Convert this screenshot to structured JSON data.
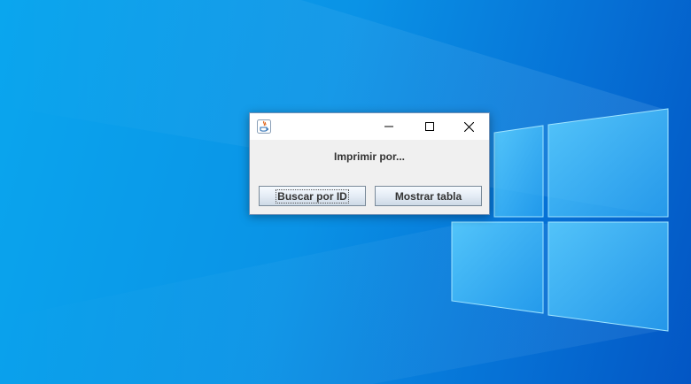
{
  "desktop": {
    "wallpaper_icon": "windows-logo-wallpaper",
    "colors": {
      "background_light": "#0aa6ee",
      "background_dark": "#0356c4"
    }
  },
  "window": {
    "title": "",
    "app_icon": "java-icon",
    "controls": {
      "minimize_icon": "minimize-icon",
      "maximize_icon": "maximize-icon",
      "close_icon": "close-icon"
    },
    "label": "Imprimir por...",
    "buttons": {
      "search_by_id": "Buscar por ID",
      "show_table": "Mostrar tabla"
    }
  }
}
